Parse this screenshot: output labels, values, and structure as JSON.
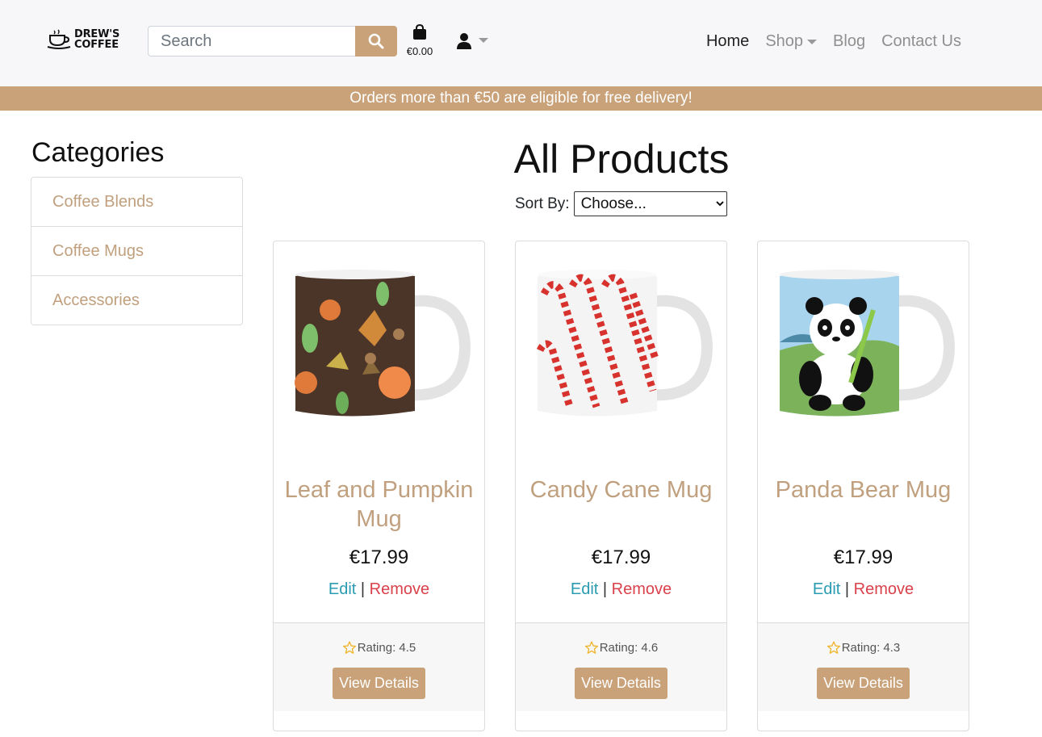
{
  "brand": {
    "line1": "DREW'S",
    "line2": "COFFEE"
  },
  "search": {
    "placeholder": "Search"
  },
  "cart": {
    "total": "€0.00"
  },
  "nav": {
    "home": "Home",
    "shop": "Shop",
    "blog": "Blog",
    "contact": "Contact Us"
  },
  "banner": {
    "text": "Orders more than €50 are eligible for free delivery!"
  },
  "sidebar": {
    "title": "Categories",
    "items": [
      {
        "label": "Coffee Blends"
      },
      {
        "label": "Coffee Mugs"
      },
      {
        "label": "Accessories"
      }
    ]
  },
  "main": {
    "title": "All Products",
    "sort_label": "Sort By:",
    "sort_selected": "Choose..."
  },
  "products": [
    {
      "name": "Leaf and Pumpkin Mug",
      "price": "€17.99",
      "edit": "Edit",
      "remove": "Remove",
      "rating": "Rating: 4.5",
      "view": "View Details"
    },
    {
      "name": "Candy Cane Mug",
      "price": "€17.99",
      "edit": "Edit",
      "remove": "Remove",
      "rating": "Rating: 4.6",
      "view": "View Details"
    },
    {
      "name": "Panda Bear Mug",
      "price": "€17.99",
      "edit": "Edit",
      "remove": "Remove",
      "rating": "Rating: 4.3",
      "view": "View Details"
    }
  ],
  "colors": {
    "accent": "#c9a27a",
    "link_text": "#c0a07e",
    "edit": "#2a9bb0",
    "remove": "#d9414b"
  },
  "icons": {
    "search": "search-icon",
    "cart": "shopping-bag-icon",
    "account": "user-icon",
    "star": "star-outline-icon"
  }
}
